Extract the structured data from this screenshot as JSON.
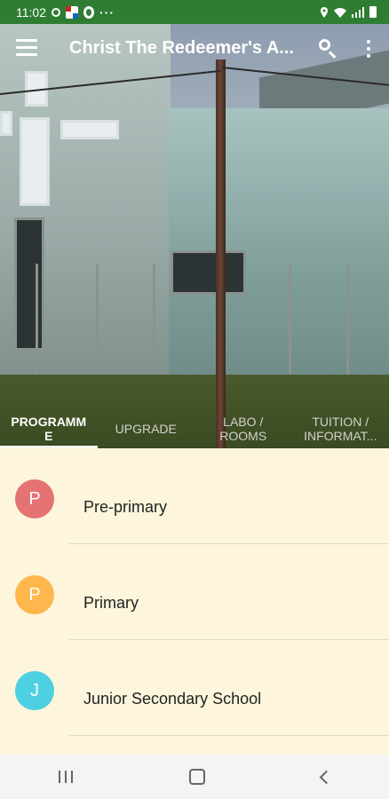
{
  "status_bar": {
    "time": "11:02",
    "overflow": "···",
    "left_icons": [
      "whatsapp-icon",
      "flag-icon",
      "opera-icon"
    ],
    "right_icons": [
      "location-pin-icon",
      "wifi-icon",
      "signal-icon",
      "battery-icon"
    ]
  },
  "toolbar": {
    "title": "Christ The Redeemer's A...",
    "menu_icon": "menu-icon",
    "search_icon": "search-icon",
    "overflow_icon": "more-vert-icon"
  },
  "tabs": [
    {
      "label": "PROGRAMM E",
      "active": true
    },
    {
      "label": "UPGRADE",
      "active": false
    },
    {
      "label": "LABO / ROOMS",
      "active": false
    },
    {
      "label": "TUITION / INFORMAT...",
      "active": false
    }
  ],
  "list": {
    "items": [
      {
        "initial": "P",
        "label": "Pre-primary",
        "color": "#e57373"
      },
      {
        "initial": "P",
        "label": "Primary",
        "color": "#ffb74d"
      },
      {
        "initial": "J",
        "label": "Junior Secondary School",
        "color": "#4dd0e1"
      }
    ]
  },
  "nav_bar": {
    "icons": [
      "recent-apps-icon",
      "home-icon",
      "back-icon"
    ]
  },
  "colors": {
    "status_bar": "#2e7d32",
    "list_background": "#fdf6dc"
  }
}
